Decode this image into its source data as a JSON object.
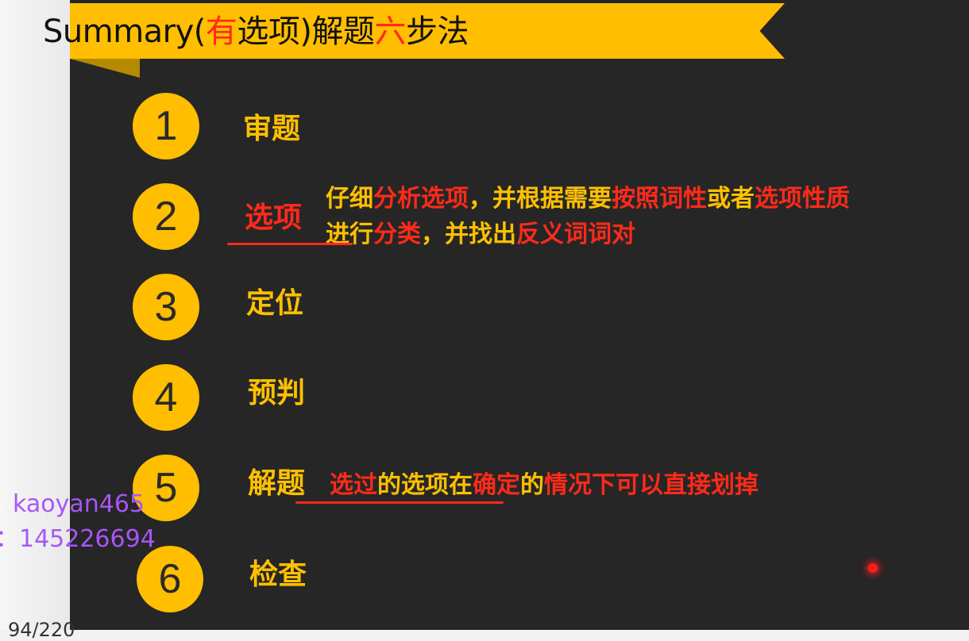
{
  "title": {
    "part1": "Summary(",
    "part2": "有",
    "part3": "选项)解题",
    "part4": "六",
    "part5": "步法"
  },
  "steps": [
    {
      "number": "1",
      "label": "审题"
    },
    {
      "number": "2",
      "label": "选项"
    },
    {
      "number": "3",
      "label": "定位"
    },
    {
      "number": "4",
      "label": "预判"
    },
    {
      "number": "5",
      "label": "解题"
    },
    {
      "number": "6",
      "label": "检查"
    }
  ],
  "step2_note": {
    "line1": [
      "仔细",
      "分析选项",
      "，并根据需要",
      "按照词性",
      "或者",
      "选项性质"
    ],
    "line2": [
      "进行",
      "分类",
      "，并找出",
      "反义词词对"
    ]
  },
  "step5_note": [
    "选过",
    "的选项在",
    "确定",
    "的",
    "情况下可以直接划掉"
  ],
  "watermark": {
    "line1": "kaoyan465",
    "line2": "：145226694"
  },
  "page_number": "94/220",
  "colors": {
    "background": "#262626",
    "accent_yellow": "#ffbe00",
    "highlight_red": "#ff2a1a",
    "watermark_purple": "#a855f7"
  }
}
